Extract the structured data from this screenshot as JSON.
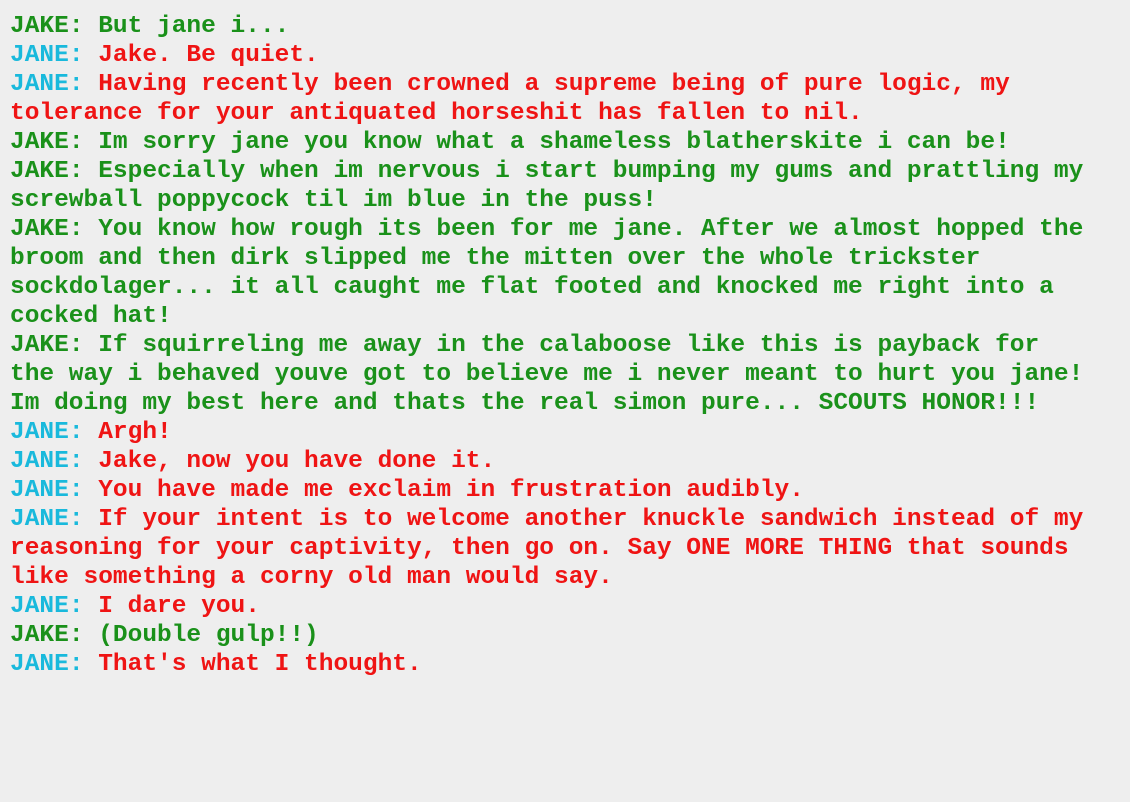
{
  "colors": {
    "background": "#eeeeee",
    "jake": "#1a911a",
    "jane_handle": "#19b9dc",
    "jane_text": "#ef1414"
  },
  "lines": [
    {
      "speaker": "JAKE",
      "text": "But jane i..."
    },
    {
      "speaker": "JANE",
      "text": "Jake. Be quiet."
    },
    {
      "speaker": "JANE",
      "text": "Having recently been crowned a supreme being of pure logic, my tolerance for your antiquated horseshit has fallen to nil."
    },
    {
      "speaker": "JAKE",
      "text": "Im sorry jane you know what a shameless blatherskite i can be!"
    },
    {
      "speaker": "JAKE",
      "text": "Especially when im nervous i start bumping my gums and prattling my screwball poppycock til im blue in the puss!"
    },
    {
      "speaker": "JAKE",
      "text": "You know how rough its been for me jane. After we almost hopped the broom and then dirk slipped me the mitten over the whole trickster sockdolager... it all caught me flat footed and knocked me right into a cocked hat!"
    },
    {
      "speaker": "JAKE",
      "text": "If squirreling me away in the calaboose like this is payback for the way i behaved youve got to believe me i never meant to hurt you jane! Im doing my best here and thats the real simon pure... SCOUTS HONOR!!!"
    },
    {
      "speaker": "JANE",
      "text": "Argh!"
    },
    {
      "speaker": "JANE",
      "text": "Jake, now you have done it."
    },
    {
      "speaker": "JANE",
      "text": "You have made me exclaim in frustration audibly."
    },
    {
      "speaker": "JANE",
      "text": "If your intent is to welcome another knuckle sandwich instead of my reasoning for your captivity, then go on. Say ONE MORE THING that sounds like something a corny old man would say."
    },
    {
      "speaker": "JANE",
      "text": "I dare you."
    },
    {
      "speaker": "JAKE",
      "text": "(Double gulp!!)"
    },
    {
      "speaker": "JANE",
      "text": "That's what I thought."
    }
  ]
}
